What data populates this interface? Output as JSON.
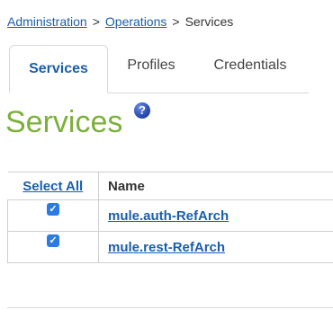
{
  "breadcrumb": {
    "items": [
      {
        "label": "Administration"
      },
      {
        "label": "Operations"
      },
      {
        "label": "Services"
      }
    ],
    "separator": ">"
  },
  "tabs": [
    {
      "label": "Services",
      "active": true
    },
    {
      "label": "Profiles",
      "active": false
    },
    {
      "label": "Credentials",
      "active": false
    }
  ],
  "page": {
    "title": "Services",
    "help_icon_glyph": "?"
  },
  "table": {
    "select_all_label": "Select All",
    "name_header": "Name",
    "rows": [
      {
        "checked": true,
        "name": "mule.auth-RefArch"
      },
      {
        "checked": true,
        "name": "mule.rest-RefArch"
      }
    ]
  },
  "colors": {
    "link": "#1a5eab",
    "title": "#7bb03a",
    "checkbox": "#2a7be4"
  }
}
